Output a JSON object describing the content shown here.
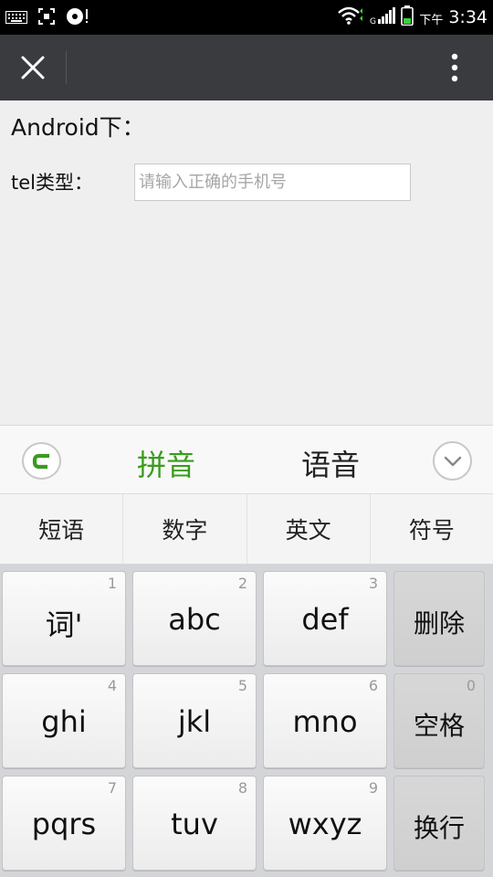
{
  "status_bar": {
    "time": "3:34",
    "ampm": "下午",
    "icons": [
      "keyboard-icon",
      "screenshot-icon",
      "disc-icon",
      "wifi-icon",
      "signal-icon",
      "battery-icon"
    ]
  },
  "title_bar": {
    "close_icon": "close-icon",
    "more_icon": "more-vertical-icon"
  },
  "content": {
    "heading": "Android下：",
    "tel_label": "tel类型：",
    "tel_placeholder": "请输入正确的手机号",
    "tel_value": ""
  },
  "keyboard": {
    "logo_icon": "logo-c-icon",
    "mode_pinyin": "拼音",
    "mode_voice": "语音",
    "collapse_icon": "chevron-down-icon",
    "mode_tabs": [
      "短语",
      "数字",
      "英文",
      "符号"
    ],
    "keys": [
      {
        "main": "词'",
        "sub": "1"
      },
      {
        "main": "abc",
        "sub": "2"
      },
      {
        "main": "def",
        "sub": "3"
      },
      {
        "main": "删除",
        "sub": ""
      },
      {
        "main": "ghi",
        "sub": "4"
      },
      {
        "main": "jkl",
        "sub": "5"
      },
      {
        "main": "mno",
        "sub": "6"
      },
      {
        "main": "空格",
        "sub": "0"
      },
      {
        "main": "pqrs",
        "sub": "7"
      },
      {
        "main": "tuv",
        "sub": "8"
      },
      {
        "main": "wxyz",
        "sub": "9"
      },
      {
        "main": "换行",
        "sub": ""
      }
    ],
    "colors": {
      "accent_green": "#3a9b1d"
    }
  }
}
